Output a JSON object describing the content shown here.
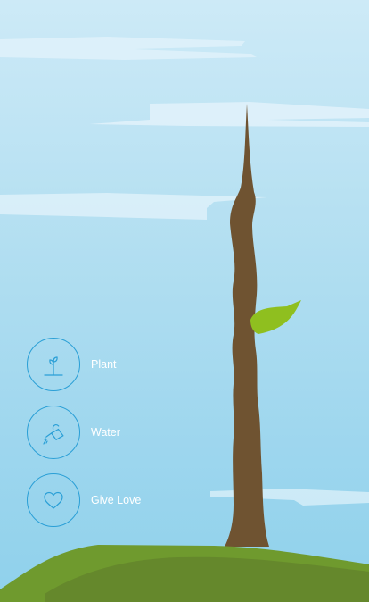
{
  "actions": [
    {
      "id": "plant",
      "label": "Plant",
      "icon": "sprout-icon"
    },
    {
      "id": "water",
      "label": "Water",
      "icon": "watering-can-icon"
    },
    {
      "id": "love",
      "label": "Give Love",
      "icon": "heart-icon"
    }
  ],
  "colors": {
    "sky_top": "#cdeaf7",
    "sky_bottom": "#8fd1eb",
    "trunk": "#6f5331",
    "leaf": "#8fbf1f",
    "grass": "#6f9a2e",
    "icon_stroke": "#2a9fd6",
    "label_text": "#ffffff"
  }
}
